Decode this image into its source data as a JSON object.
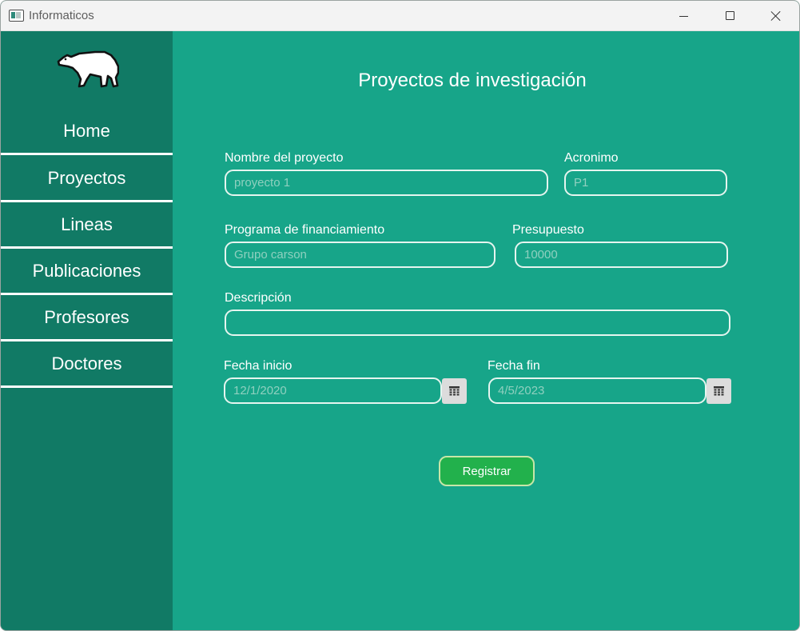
{
  "window": {
    "title": "Informaticos"
  },
  "sidebar": {
    "items": [
      {
        "label": "Home"
      },
      {
        "label": "Proyectos"
      },
      {
        "label": "Lineas"
      },
      {
        "label": "Publicaciones"
      },
      {
        "label": "Profesores"
      },
      {
        "label": "Doctores"
      }
    ]
  },
  "form": {
    "title": "Proyectos de investigación",
    "nombre": {
      "label": "Nombre del proyecto",
      "placeholder": "proyecto 1"
    },
    "acronimo": {
      "label": "Acronimo",
      "placeholder": "P1"
    },
    "programa": {
      "label": "Programa de financiamiento",
      "placeholder": "Grupo carson"
    },
    "presupuesto": {
      "label": "Presupuesto",
      "placeholder": "10000"
    },
    "descripcion": {
      "label": "Descripción",
      "placeholder": ""
    },
    "fecha_inicio": {
      "label": "Fecha inicio",
      "placeholder": "12/1/2020"
    },
    "fecha_fin": {
      "label": "Fecha fin",
      "placeholder": "4/5/2023"
    },
    "submit_label": "Registrar"
  },
  "colors": {
    "main_bg": "#17a589",
    "sidebar_bg": "#117a65",
    "button_bg": "#22b14c"
  },
  "icons": [
    "app-window-icon",
    "polar-bear-logo",
    "calendar-icon",
    "minimize-icon",
    "maximize-icon",
    "close-icon"
  ]
}
